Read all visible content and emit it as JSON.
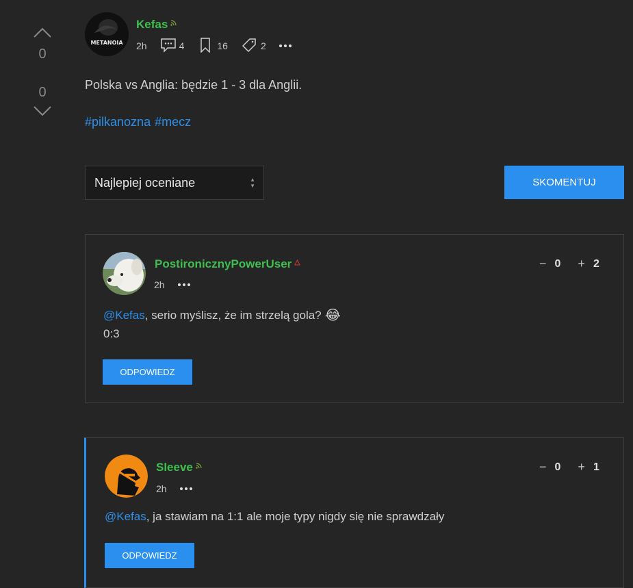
{
  "post": {
    "votes_up": "0",
    "votes_down": "0",
    "author": "Kefas",
    "avatar_text": "METANOIA",
    "time": "2h",
    "comments_count": "4",
    "bookmarks_count": "16",
    "tags_count": "2",
    "body": "Polska vs Anglia: będzie 1 - 3 dla Anglii.",
    "tags": [
      "#pilkanozna",
      "#mecz"
    ]
  },
  "controls": {
    "sort_selected": "Najlepiej oceniane",
    "comment_button": "SKOMENTUJ"
  },
  "comments": [
    {
      "author": "PostironicznyPowerUser",
      "time": "2h",
      "minus": "0",
      "plus": "2",
      "mention": "@Kefas",
      "text": ", serio myślisz, że im strzelą gola?",
      "emoji": "😂",
      "text2": "0:3",
      "reply": "ODPOWIEDZ"
    },
    {
      "author": "Sleeve",
      "time": "2h",
      "minus": "0",
      "plus": "1",
      "mention": "@Kefas",
      "text": ", ja stawiam na 1:1 ale moje typy nigdy się nie sprawdzały",
      "reply": "ODPOWIEDZ"
    }
  ],
  "colors": {
    "username": "#3fbf4f",
    "accent": "#2b8ff0",
    "link": "#2f8fe8",
    "background": "#252525"
  }
}
